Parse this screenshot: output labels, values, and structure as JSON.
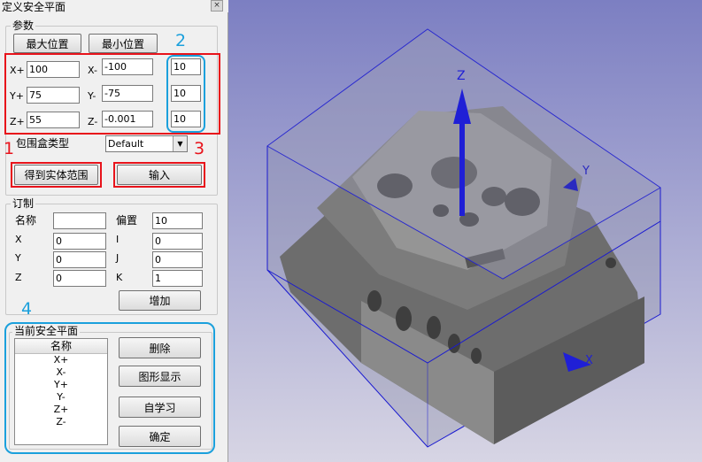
{
  "window": {
    "title": "定义安全平面",
    "close_glyph": "×"
  },
  "params": {
    "legend": "参数",
    "max_pos_label": "最大位置",
    "min_pos_label": "最小位置",
    "xplus_label": "X+",
    "xplus_value": "100",
    "xminus_label": "X-",
    "xminus_value": "-100",
    "yplus_label": "Y+",
    "yplus_value": "75",
    "yminus_label": "Y-",
    "yminus_value": "-75",
    "zplus_label": "Z+",
    "zplus_value": "55",
    "zminus_label": "Z-",
    "zminus_value": "-0.001",
    "col3": [
      "10",
      "10",
      "10"
    ],
    "bbox_type_label": "包围盒类型",
    "bbox_type_value": "Default",
    "get_range_label": "得到实体范围",
    "input_label": "输入"
  },
  "custom": {
    "legend": "订制",
    "name_label": "名称",
    "name_value": "",
    "offset_label": "偏置",
    "offset_value": "10",
    "x_label": "X",
    "x_value": "0",
    "i_label": "I",
    "i_value": "0",
    "y_label": "Y",
    "y_value": "0",
    "j_label": "J",
    "j_value": "0",
    "z_label": "Z",
    "z_value": "0",
    "k_label": "K",
    "k_value": "1",
    "add_label": "增加"
  },
  "current": {
    "legend": "当前安全平面",
    "list_header": "名称",
    "items": [
      "X+",
      "X-",
      "Y+",
      "Y-",
      "Z+",
      "Z-"
    ],
    "delete_label": "删除",
    "show_label": "图形显示",
    "learn_label": "自学习",
    "ok_label": "确定"
  },
  "annotations": {
    "a1": "1",
    "a2": "2",
    "a3": "3",
    "a4": "4"
  },
  "viewport": {
    "axis_z": "Z",
    "axis_y": "Y",
    "axis_x": "X",
    "colors": {
      "z_arrow": "#1f1fd6",
      "bbox_edge": "#1a1ad0",
      "background_top": "#7c7fc2",
      "background_bottom": "#d7d5e4"
    }
  }
}
